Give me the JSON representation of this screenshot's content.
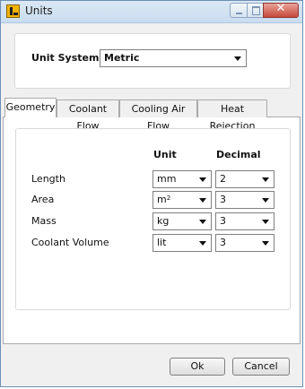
{
  "window": {
    "title": "Units",
    "close_glyph": "✕"
  },
  "unit_system": {
    "label": "Unit System",
    "selected": "Metric"
  },
  "tabs": [
    {
      "label": "Geometry",
      "active": true
    },
    {
      "label": "Coolant Flow",
      "active": false
    },
    {
      "label": "Cooling Air Flow",
      "active": false
    },
    {
      "label": "Heat Rejection",
      "active": false
    }
  ],
  "geometry": {
    "unit_header": "Unit",
    "decimal_header": "Decimal",
    "rows": [
      {
        "label": "Length",
        "unit": "mm",
        "decimal": "2"
      },
      {
        "label": "Area",
        "unit": "m",
        "unit_sup": "2",
        "decimal": "3"
      },
      {
        "label": "Mass",
        "unit": "kg",
        "decimal": "3"
      },
      {
        "label": "Coolant Volume",
        "unit": "lit",
        "decimal": "3"
      }
    ]
  },
  "buttons": {
    "ok": "Ok",
    "cancel": "Cancel"
  },
  "icons": {
    "app": "app-logo-icon",
    "dropdown": "chevron-down-icon"
  }
}
